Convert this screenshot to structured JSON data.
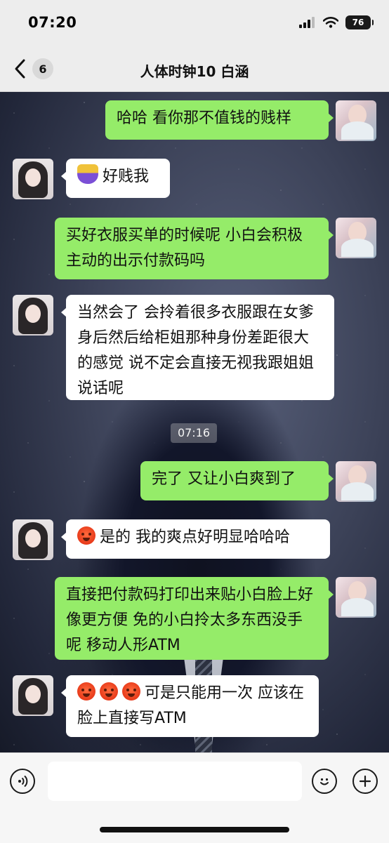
{
  "status_bar": {
    "time": "07:20",
    "battery": "76"
  },
  "nav": {
    "unread_count": "6",
    "title": "人体时钟10 白涵"
  },
  "messages": [
    {
      "text": "哈哈 看你那不值钱的贱样"
    },
    {
      "text": "好贱我"
    },
    {
      "text": "买好衣服买单的时候呢 小白会积极主动的出示付款码吗"
    },
    {
      "text": "当然会了 会拎着很多衣服跟在女爹身后然后给柜姐那种身份差距很大的感觉 说不定会直接无视我跟姐姐说话呢"
    },
    {
      "text": "完了 又让小白爽到了"
    },
    {
      "text": "是的 我的爽点好明显哈哈哈"
    },
    {
      "text": "直接把付款码打印出来贴小白脸上好像更方便 免的小白拎太多东西没手呢 移动人形ATM"
    },
    {
      "text": "可是只能用一次 应该在脸上直接写ATM"
    }
  ],
  "timestamp": "07:16",
  "input": {
    "placeholder": ""
  },
  "icons": {
    "back": "chevron-left-icon",
    "voice": "voice-icon",
    "emoji": "emoji-icon",
    "plus": "plus-icon"
  },
  "colors": {
    "my_bubble": "#95ec69",
    "other_bubble": "#ffffff",
    "background": "#ededed"
  }
}
